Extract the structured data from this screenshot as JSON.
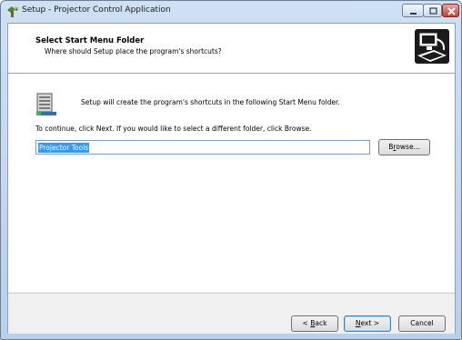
{
  "window": {
    "title": "Setup - Projector Control Application"
  },
  "header": {
    "title": "Select Start Menu Folder",
    "subtitle": "Where should Setup place the program's shortcuts?"
  },
  "body": {
    "info": "Setup will create the program's shortcuts in the following Start Menu folder.",
    "instruction": "To continue, click Next. If you would like to select a different folder, click Browse.",
    "folder_value": "Projector Tools"
  },
  "buttons": {
    "browse_pre": "B",
    "browse_acc": "r",
    "browse_post": "owse...",
    "back_pre": "< ",
    "back_acc": "B",
    "back_post": "ack",
    "next_acc": "N",
    "next_post": "ext >",
    "cancel": "Cancel"
  }
}
